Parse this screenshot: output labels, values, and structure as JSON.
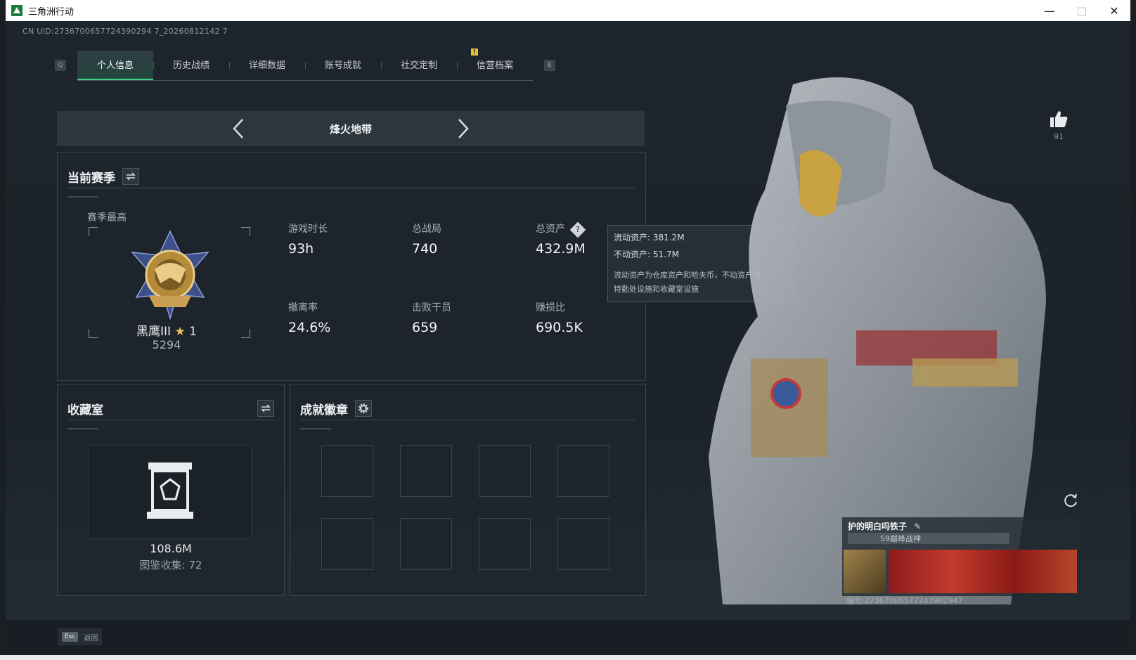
{
  "window": {
    "title": "三角洲行动"
  },
  "uid_text": "CN UID:2736700657724390294 7_20260812142 7",
  "tabs": {
    "left_key": "Q",
    "right_key": "E",
    "items": [
      "个人信息",
      "历史战绩",
      "详细数据",
      "账号成就",
      "社交定制",
      "信营档案"
    ],
    "badge": "!"
  },
  "mode": {
    "title": "烽火地带"
  },
  "season": {
    "title": "当前赛季",
    "best_label": "赛季最高",
    "rank_name": "黑鹰III",
    "rank_stars": "1",
    "rank_score": "5294",
    "stats": {
      "playtime": {
        "label": "游戏时长",
        "value": "93h"
      },
      "matches": {
        "label": "总战局",
        "value": "740"
      },
      "assets": {
        "label": "总资产",
        "value": "432.9M"
      },
      "extract": {
        "label": "撤离率",
        "value": "24.6%"
      },
      "kills": {
        "label": "击败干员",
        "value": "659"
      },
      "ratio": {
        "label": "赚损比",
        "value": "690.5K"
      }
    }
  },
  "tooltip": {
    "liquid": "流动资产: 381.2M",
    "fixed": "不动资产: 51.7M",
    "desc1": "流动资产为仓库资产和哈夫币，不动资产为",
    "desc2": "特勤处设施和收藏室设施"
  },
  "vault": {
    "title": "收藏室",
    "value": "108.6M",
    "count": "图鉴收集: 72"
  },
  "badges": {
    "title": "成就徽章"
  },
  "likes": {
    "count": "91"
  },
  "card": {
    "name": "护的明白吗铁子",
    "subtitle": "S9巅峰战神",
    "id": "编号:27367006577243902947"
  },
  "footer": {
    "esc_key": "Esc",
    "esc_label": "返回"
  }
}
